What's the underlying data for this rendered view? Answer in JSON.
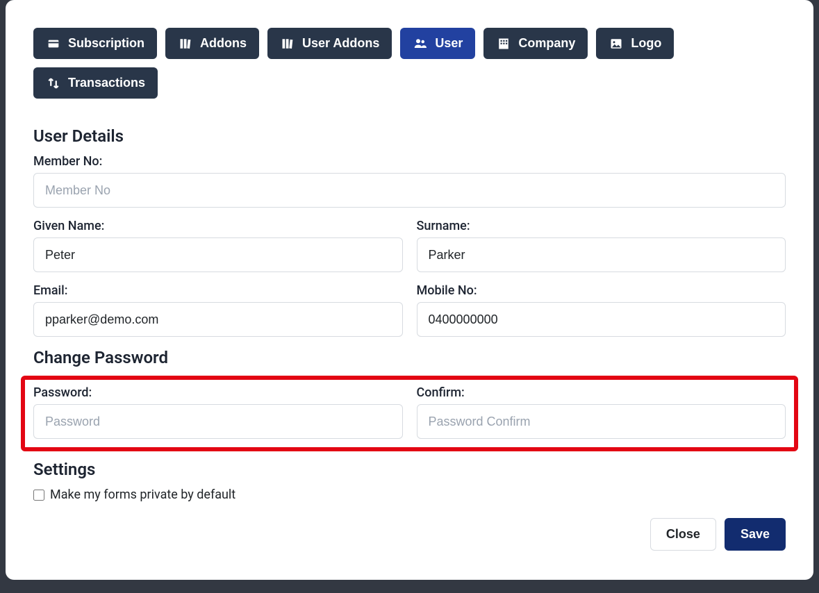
{
  "tabs": [
    {
      "label": "Subscription",
      "icon": "card-icon",
      "active": false
    },
    {
      "label": "Addons",
      "icon": "books-icon",
      "active": false
    },
    {
      "label": "User Addons",
      "icon": "books-icon",
      "active": false
    },
    {
      "label": "User",
      "icon": "users-icon",
      "active": true
    },
    {
      "label": "Company",
      "icon": "building-icon",
      "active": false
    },
    {
      "label": "Logo",
      "icon": "image-icon",
      "active": false
    },
    {
      "label": "Transactions",
      "icon": "transfer-icon",
      "active": false
    }
  ],
  "sections": {
    "user_details_title": "User Details",
    "change_password_title": "Change Password",
    "settings_title": "Settings"
  },
  "fields": {
    "member_no": {
      "label": "Member No:",
      "placeholder": "Member No",
      "value": ""
    },
    "given_name": {
      "label": "Given Name:",
      "placeholder": "",
      "value": "Peter"
    },
    "surname": {
      "label": "Surname:",
      "placeholder": "",
      "value": "Parker"
    },
    "email": {
      "label": "Email:",
      "placeholder": "",
      "value": "pparker@demo.com"
    },
    "mobile": {
      "label": "Mobile No:",
      "placeholder": "",
      "value": "0400000000"
    },
    "password": {
      "label": "Password:",
      "placeholder": "Password",
      "value": ""
    },
    "confirm": {
      "label": "Confirm:",
      "placeholder": "Password Confirm",
      "value": ""
    }
  },
  "settings": {
    "private_forms_label": "Make my forms private by default",
    "private_forms_checked": false
  },
  "actions": {
    "close_label": "Close",
    "save_label": "Save"
  }
}
